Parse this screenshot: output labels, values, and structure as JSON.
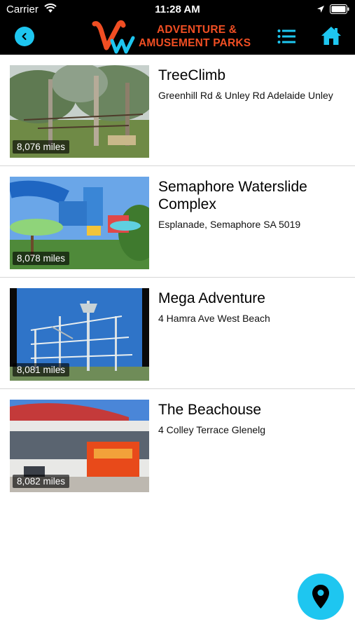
{
  "status_bar": {
    "carrier": "Carrier",
    "time": "11:28 AM"
  },
  "header": {
    "logo_line1": "ADVENTURE &",
    "logo_line2": "AMUSEMENT PARKS",
    "accent_color": "#1ec6f0",
    "brand_color": "#f04e23",
    "icons": [
      "back-icon",
      "list-icon",
      "home-icon"
    ]
  },
  "parks": [
    {
      "name": "TreeClimb",
      "address": "Greenhill Rd & Unley Rd Adelaide Unley",
      "distance": "8,076 miles"
    },
    {
      "name": "Semaphore Waterslide Complex",
      "address": "Esplanade, Semaphore SA 5019",
      "distance": "8,078 miles"
    },
    {
      "name": "Mega Adventure",
      "address": "4 Hamra Ave West Beach",
      "distance": "8,081 miles"
    },
    {
      "name": "The Beachouse",
      "address": "4 Colley Terrace Glenelg",
      "distance": "8,082 miles"
    }
  ],
  "fab": {
    "icon": "map-pin-icon"
  }
}
